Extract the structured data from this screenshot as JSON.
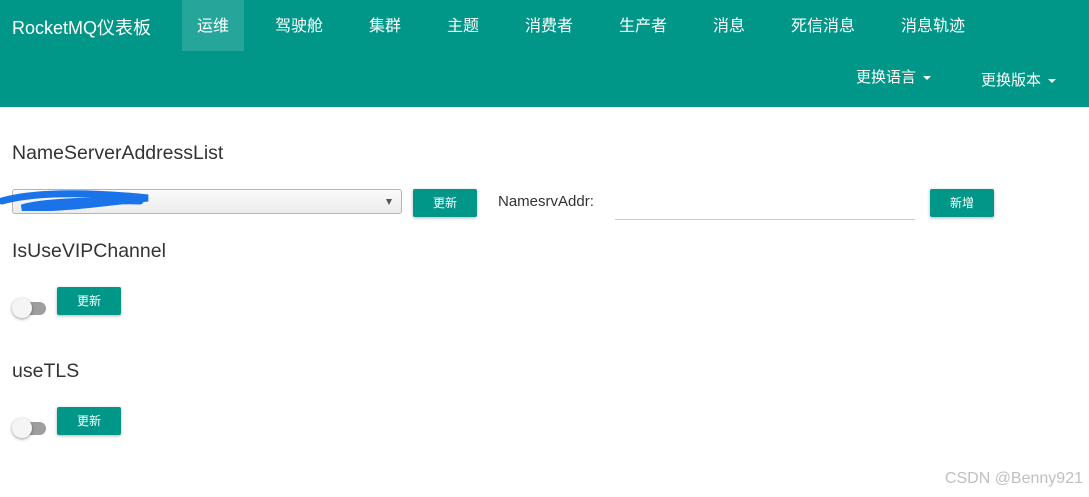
{
  "nav": {
    "brand": "RocketMQ仪表板",
    "items": [
      "运维",
      "驾驶舱",
      "集群",
      "主题",
      "消费者",
      "生产者",
      "消息",
      "死信消息",
      "消息轨迹"
    ],
    "active_index": 0,
    "language_label": "更换语言",
    "version_label": "更换版本"
  },
  "nameserver": {
    "title": "NameServerAddressList",
    "update_label": "更新",
    "addr_label": "NamesrvAddr:",
    "addr_value": "",
    "add_label": "新增"
  },
  "vip_channel": {
    "title": "IsUseVIPChannel",
    "enabled": false,
    "update_label": "更新"
  },
  "tls": {
    "title": "useTLS",
    "enabled": false,
    "update_label": "更新"
  },
  "watermark": "CSDN @Benny921",
  "colors": {
    "primary": "#009688",
    "nav_active": "#26a69a",
    "redaction": "#1a73e8"
  }
}
